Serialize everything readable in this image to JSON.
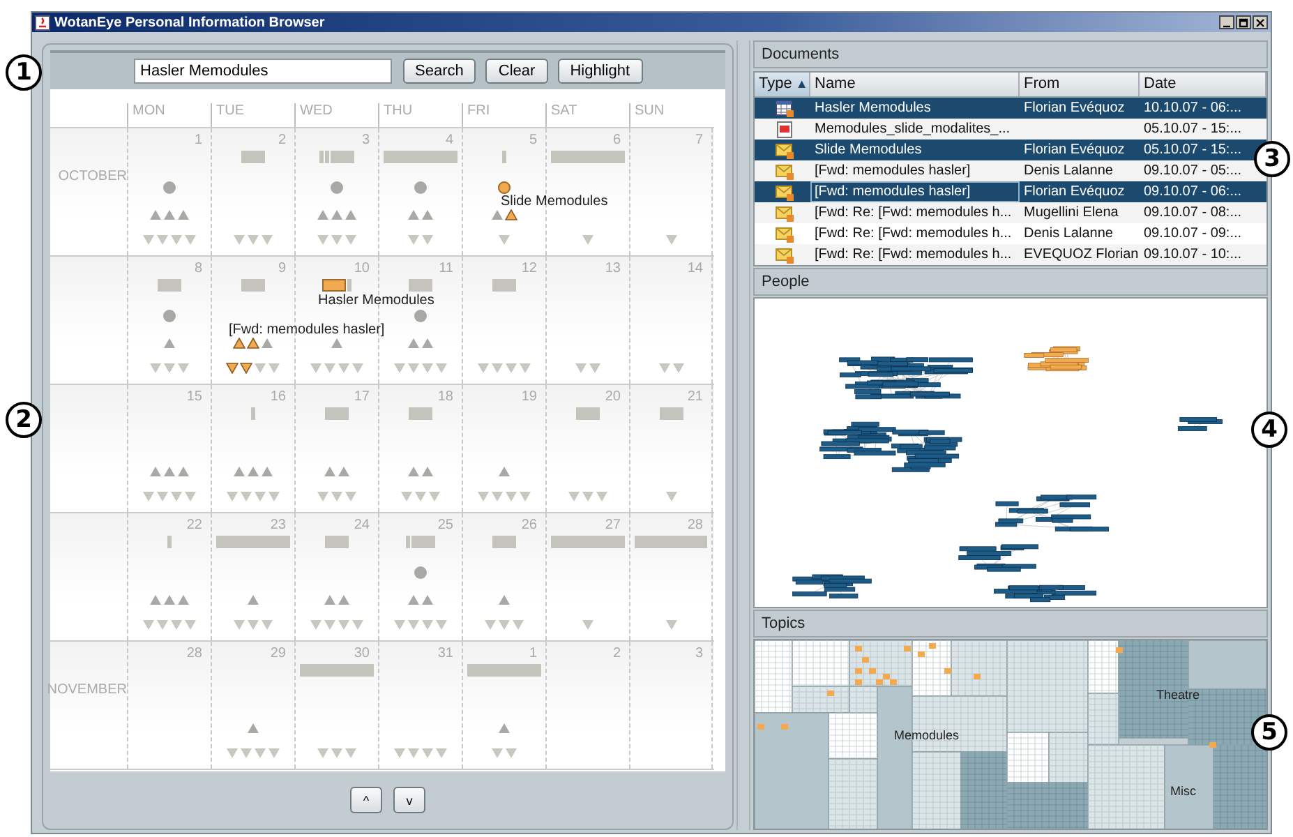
{
  "window": {
    "title": "WotanEye Personal Information Browser"
  },
  "search": {
    "value": "Hasler Memodules",
    "buttons": [
      "Search",
      "Clear",
      "Highlight"
    ]
  },
  "calendar": {
    "weekdays": [
      "MON",
      "TUE",
      "WED",
      "THU",
      "FRI",
      "SAT",
      "SUN"
    ],
    "weeks": [
      {
        "month": "OCTOBER",
        "days": [
          {
            "day": "1",
            "marks": [
              {
                "kind": "dot",
                "highlighted": false
              },
              {
                "kind": "up",
                "highlighted": false
              },
              {
                "kind": "up",
                "highlighted": false
              },
              {
                "kind": "up",
                "highlighted": false
              },
              {
                "kind": "down",
                "highlighted": false
              },
              {
                "kind": "down",
                "highlighted": false
              },
              {
                "kind": "down",
                "highlighted": false
              },
              {
                "kind": "down",
                "highlighted": false
              }
            ]
          },
          {
            "day": "2",
            "marks": [
              {
                "kind": "bar",
                "highlighted": false
              },
              {
                "kind": "down",
                "highlighted": false
              },
              {
                "kind": "down",
                "highlighted": false
              },
              {
                "kind": "down",
                "highlighted": false
              }
            ]
          },
          {
            "day": "3",
            "marks": [
              {
                "kind": "tick",
                "highlighted": false
              },
              {
                "kind": "tick",
                "highlighted": false
              },
              {
                "kind": "bar",
                "highlighted": false
              },
              {
                "kind": "dot",
                "highlighted": false
              },
              {
                "kind": "up",
                "highlighted": false
              },
              {
                "kind": "up",
                "highlighted": false
              },
              {
                "kind": "up",
                "highlighted": false
              },
              {
                "kind": "down",
                "highlighted": false
              },
              {
                "kind": "down",
                "highlighted": false
              },
              {
                "kind": "down",
                "highlighted": false
              }
            ]
          },
          {
            "day": "4",
            "marks": [
              {
                "kind": "wide",
                "highlighted": false
              },
              {
                "kind": "dot",
                "highlighted": false
              },
              {
                "kind": "up",
                "highlighted": false
              },
              {
                "kind": "up",
                "highlighted": false
              },
              {
                "kind": "down",
                "highlighted": false
              },
              {
                "kind": "down",
                "highlighted": false
              }
            ]
          },
          {
            "day": "5",
            "marks": [
              {
                "kind": "tick",
                "highlighted": false
              },
              {
                "kind": "dot",
                "highlighted": true
              },
              {
                "kind": "up",
                "highlighted": false
              },
              {
                "kind": "up",
                "highlighted": true,
                "label": "Slide Memodules"
              },
              {
                "kind": "down",
                "highlighted": false
              }
            ]
          },
          {
            "day": "6",
            "marks": [
              {
                "kind": "wide",
                "highlighted": false
              },
              {
                "kind": "down",
                "highlighted": false
              }
            ]
          },
          {
            "day": "7",
            "marks": [
              {
                "kind": "down",
                "highlighted": false
              }
            ]
          }
        ]
      },
      {
        "days": [
          {
            "day": "8",
            "marks": [
              {
                "kind": "bar",
                "highlighted": false
              },
              {
                "kind": "dot",
                "highlighted": false
              },
              {
                "kind": "up",
                "highlighted": false
              },
              {
                "kind": "down",
                "highlighted": false
              },
              {
                "kind": "down",
                "highlighted": false
              },
              {
                "kind": "down",
                "highlighted": false
              }
            ]
          },
          {
            "day": "9",
            "marks": [
              {
                "kind": "bar",
                "highlighted": false
              },
              {
                "kind": "up",
                "highlighted": true,
                "label": "[Fwd: memodules hasler]"
              },
              {
                "kind": "up",
                "highlighted": true
              },
              {
                "kind": "up",
                "highlighted": false
              },
              {
                "kind": "down",
                "highlighted": true
              },
              {
                "kind": "down",
                "highlighted": true
              },
              {
                "kind": "down",
                "highlighted": false
              },
              {
                "kind": "down",
                "highlighted": false
              }
            ]
          },
          {
            "day": "10",
            "marks": [
              {
                "kind": "bar",
                "highlighted": true,
                "label": "Hasler Memodules"
              },
              {
                "kind": "tick",
                "highlighted": false
              },
              {
                "kind": "up",
                "highlighted": false
              },
              {
                "kind": "down",
                "highlighted": false
              },
              {
                "kind": "down",
                "highlighted": false
              },
              {
                "kind": "down",
                "highlighted": false
              },
              {
                "kind": "down",
                "highlighted": false
              }
            ]
          },
          {
            "day": "11",
            "marks": [
              {
                "kind": "bar",
                "highlighted": false
              },
              {
                "kind": "dot",
                "highlighted": false
              },
              {
                "kind": "up",
                "highlighted": false
              },
              {
                "kind": "up",
                "highlighted": false
              },
              {
                "kind": "down",
                "highlighted": false
              },
              {
                "kind": "down",
                "highlighted": false
              },
              {
                "kind": "down",
                "highlighted": false
              },
              {
                "kind": "down",
                "highlighted": false
              }
            ]
          },
          {
            "day": "12",
            "marks": [
              {
                "kind": "bar",
                "highlighted": false
              },
              {
                "kind": "down",
                "highlighted": false
              },
              {
                "kind": "down",
                "highlighted": false
              },
              {
                "kind": "down",
                "highlighted": false
              },
              {
                "kind": "down",
                "highlighted": false
              }
            ]
          },
          {
            "day": "13",
            "marks": [
              {
                "kind": "down",
                "highlighted": false
              },
              {
                "kind": "down",
                "highlighted": false
              }
            ]
          },
          {
            "day": "14",
            "marks": [
              {
                "kind": "down",
                "highlighted": false
              },
              {
                "kind": "down",
                "highlighted": false
              }
            ]
          }
        ]
      },
      {
        "days": [
          {
            "day": "15",
            "marks": [
              {
                "kind": "up",
                "highlighted": false
              },
              {
                "kind": "up",
                "highlighted": false
              },
              {
                "kind": "up",
                "highlighted": false
              },
              {
                "kind": "down",
                "highlighted": false
              },
              {
                "kind": "down",
                "highlighted": false
              },
              {
                "kind": "down",
                "highlighted": false
              },
              {
                "kind": "down",
                "highlighted": false
              }
            ]
          },
          {
            "day": "16",
            "marks": [
              {
                "kind": "tick",
                "highlighted": false
              },
              {
                "kind": "up",
                "highlighted": false
              },
              {
                "kind": "up",
                "highlighted": false
              },
              {
                "kind": "up",
                "highlighted": false
              },
              {
                "kind": "down",
                "highlighted": false
              },
              {
                "kind": "down",
                "highlighted": false
              },
              {
                "kind": "down",
                "highlighted": false
              },
              {
                "kind": "down",
                "highlighted": false
              }
            ]
          },
          {
            "day": "17",
            "marks": [
              {
                "kind": "bar",
                "highlighted": false
              },
              {
                "kind": "up",
                "highlighted": false
              },
              {
                "kind": "up",
                "highlighted": false
              },
              {
                "kind": "down",
                "highlighted": false
              },
              {
                "kind": "down",
                "highlighted": false
              },
              {
                "kind": "down",
                "highlighted": false
              }
            ]
          },
          {
            "day": "18",
            "marks": [
              {
                "kind": "bar",
                "highlighted": false
              },
              {
                "kind": "up",
                "highlighted": false
              },
              {
                "kind": "up",
                "highlighted": false
              },
              {
                "kind": "down",
                "highlighted": false
              },
              {
                "kind": "down",
                "highlighted": false
              },
              {
                "kind": "down",
                "highlighted": false
              }
            ]
          },
          {
            "day": "19",
            "marks": [
              {
                "kind": "up",
                "highlighted": false
              },
              {
                "kind": "down",
                "highlighted": false
              },
              {
                "kind": "down",
                "highlighted": false
              },
              {
                "kind": "down",
                "highlighted": false
              },
              {
                "kind": "down",
                "highlighted": false
              }
            ]
          },
          {
            "day": "20",
            "marks": [
              {
                "kind": "bar",
                "highlighted": false
              },
              {
                "kind": "down",
                "highlighted": false
              },
              {
                "kind": "down",
                "highlighted": false
              },
              {
                "kind": "down",
                "highlighted": false
              }
            ]
          },
          {
            "day": "21",
            "marks": [
              {
                "kind": "bar",
                "highlighted": false
              },
              {
                "kind": "down",
                "highlighted": false
              }
            ]
          }
        ]
      },
      {
        "days": [
          {
            "day": "22",
            "marks": [
              {
                "kind": "tick",
                "highlighted": false
              },
              {
                "kind": "up",
                "highlighted": false
              },
              {
                "kind": "up",
                "highlighted": false
              },
              {
                "kind": "up",
                "highlighted": false
              },
              {
                "kind": "down",
                "highlighted": false
              },
              {
                "kind": "down",
                "highlighted": false
              },
              {
                "kind": "down",
                "highlighted": false
              },
              {
                "kind": "down",
                "highlighted": false
              }
            ]
          },
          {
            "day": "23",
            "marks": [
              {
                "kind": "wide",
                "highlighted": false
              },
              {
                "kind": "up",
                "highlighted": false
              },
              {
                "kind": "down",
                "highlighted": false
              },
              {
                "kind": "down",
                "highlighted": false
              },
              {
                "kind": "down",
                "highlighted": false
              }
            ]
          },
          {
            "day": "24",
            "marks": [
              {
                "kind": "bar",
                "highlighted": false
              },
              {
                "kind": "up",
                "highlighted": false
              },
              {
                "kind": "up",
                "highlighted": false
              },
              {
                "kind": "down",
                "highlighted": false
              },
              {
                "kind": "down",
                "highlighted": false
              },
              {
                "kind": "down",
                "highlighted": false
              },
              {
                "kind": "down",
                "highlighted": false
              }
            ]
          },
          {
            "day": "25",
            "marks": [
              {
                "kind": "tick",
                "highlighted": false
              },
              {
                "kind": "bar",
                "highlighted": false
              },
              {
                "kind": "dot",
                "highlighted": false
              },
              {
                "kind": "up",
                "highlighted": false
              },
              {
                "kind": "up",
                "highlighted": false
              },
              {
                "kind": "down",
                "highlighted": false
              },
              {
                "kind": "down",
                "highlighted": false
              },
              {
                "kind": "down",
                "highlighted": false
              },
              {
                "kind": "down",
                "highlighted": false
              }
            ]
          },
          {
            "day": "26",
            "marks": [
              {
                "kind": "bar",
                "highlighted": false
              },
              {
                "kind": "up",
                "highlighted": false
              },
              {
                "kind": "down",
                "highlighted": false
              },
              {
                "kind": "down",
                "highlighted": false
              },
              {
                "kind": "down",
                "highlighted": false
              }
            ]
          },
          {
            "day": "27",
            "marks": [
              {
                "kind": "wide",
                "highlighted": false
              },
              {
                "kind": "down",
                "highlighted": false
              }
            ]
          },
          {
            "day": "28",
            "marks": [
              {
                "kind": "wide",
                "highlighted": false
              },
              {
                "kind": "down",
                "highlighted": false
              }
            ]
          }
        ]
      },
      {
        "month": "NOVEMBER",
        "days": [
          {
            "day": "28"
          },
          {
            "day": "29",
            "marks": [
              {
                "kind": "up",
                "highlighted": false
              },
              {
                "kind": "down",
                "highlighted": false
              },
              {
                "kind": "down",
                "highlighted": false
              },
              {
                "kind": "down",
                "highlighted": false
              },
              {
                "kind": "down",
                "highlighted": false
              }
            ]
          },
          {
            "day": "30",
            "marks": [
              {
                "kind": "wide",
                "highlighted": false
              },
              {
                "kind": "down",
                "highlighted": false
              },
              {
                "kind": "down",
                "highlighted": false
              },
              {
                "kind": "down",
                "highlighted": false
              }
            ]
          },
          {
            "day": "31",
            "marks": [
              {
                "kind": "down",
                "highlighted": false
              },
              {
                "kind": "down",
                "highlighted": false
              },
              {
                "kind": "down",
                "highlighted": false
              },
              {
                "kind": "down",
                "highlighted": false
              }
            ]
          },
          {
            "day": "1",
            "marks": [
              {
                "kind": "wide",
                "highlighted": false
              },
              {
                "kind": "up",
                "highlighted": false
              },
              {
                "kind": "down",
                "highlighted": false
              },
              {
                "kind": "down",
                "highlighted": false
              }
            ]
          },
          {
            "day": "2"
          },
          {
            "day": "3"
          }
        ]
      }
    ],
    "nav_buttons": [
      "^",
      "v"
    ]
  },
  "documents": {
    "title": "Documents",
    "columns": [
      {
        "label": "Type",
        "sort_arrow": "▲"
      },
      {
        "label": "Name"
      },
      {
        "label": "From"
      },
      {
        "label": "Date"
      }
    ],
    "rows": [
      {
        "kind": "calendar",
        "name": "Hasler Memodules",
        "from": "Florian Evéquoz",
        "date": "10.10.07 - 06:...",
        "selected": true,
        "focused": false
      },
      {
        "kind": "presentation",
        "name": "Memodules_slide_modalites_...",
        "date": "05.10.07 - 15:...",
        "selected": false,
        "focused": false
      },
      {
        "kind": "mail",
        "name": "Slide Memodules",
        "from": "Florian Evéquoz",
        "date": "05.10.07 - 15:...",
        "selected": true,
        "focused": false
      },
      {
        "kind": "mail",
        "name": "[Fwd: memodules hasler]",
        "from": "Denis Lalanne",
        "date": "09.10.07 - 05:...",
        "selected": false,
        "focused": false
      },
      {
        "kind": "mail",
        "name": "[Fwd: memodules hasler]",
        "from": "Florian Evéquoz",
        "date": "09.10.07 - 06:...",
        "selected": true,
        "focused": true
      },
      {
        "kind": "mail",
        "name": "[Fwd: Re: [Fwd: memodules h...",
        "from": "Mugellini Elena",
        "date": "09.10.07 - 08:...",
        "selected": false,
        "focused": false
      },
      {
        "kind": "mail",
        "name": "[Fwd: Re: [Fwd: memodules h...",
        "from": "Denis Lalanne",
        "date": "09.10.07 - 09:...",
        "selected": false,
        "focused": false
      },
      {
        "kind": "mail",
        "name": "[Fwd: Re: [Fwd: memodules h...",
        "from": "EVEQUOZ Florian",
        "date": "09.10.07 - 10:...",
        "selected": false,
        "focused": false
      }
    ]
  },
  "people": {
    "title": "People"
  },
  "topics": {
    "title": "Topics",
    "labels": [
      "Memodules",
      "Theatre",
      "Misc"
    ]
  },
  "callouts": [
    "1",
    "2",
    "3",
    "4",
    "5"
  ]
}
